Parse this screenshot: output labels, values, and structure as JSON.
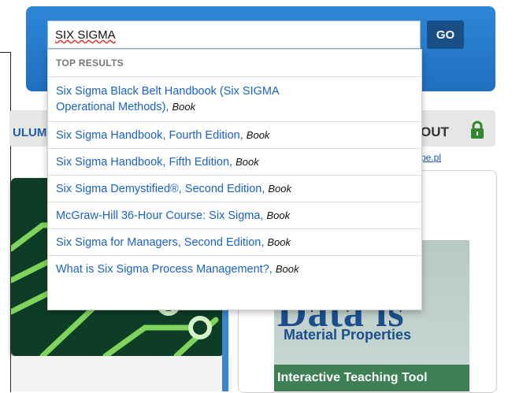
{
  "search": {
    "value": "SIX SIGMA",
    "go_label": "GO"
  },
  "dropdown": {
    "header": "TOP RESULTS",
    "items": [
      {
        "title_line1": "Six Sigma Black Belt Handbook (Six SIGMA",
        "title_line2": "Operational Methods),",
        "kind": "Book"
      },
      {
        "title_line1": "Six Sigma Handbook, Fourth Edition,",
        "title_line2": "",
        "kind": "Book"
      },
      {
        "title_line1": "Six Sigma Handbook, Fifth Edition,",
        "title_line2": "",
        "kind": "Book"
      },
      {
        "title_line1": "Six Sigma Demystified®, Second Edition,",
        "title_line2": "",
        "kind": "Book"
      },
      {
        "title_line1": "McGraw-Hill 36-Hour Course: Six Sigma,",
        "title_line2": "",
        "kind": "Book"
      },
      {
        "title_line1": "Six Sigma for Managers, Second Edition,",
        "title_line2": "",
        "kind": "Book"
      },
      {
        "title_line1": "What is Six Sigma Process Management?,",
        "title_line2": "",
        "kind": "Book"
      }
    ]
  },
  "nav": {
    "left_partial": "ULUM",
    "right_partial": "OUT"
  },
  "partner_link": "pe.pl",
  "ad": {
    "brand": "Data is",
    "subtitle": "Material Properties",
    "banner": "Interactive Teaching Tool"
  },
  "colors": {
    "search_panel": "#2e86d6",
    "go_button": "#1a4e86",
    "link": "#1b62c0"
  }
}
